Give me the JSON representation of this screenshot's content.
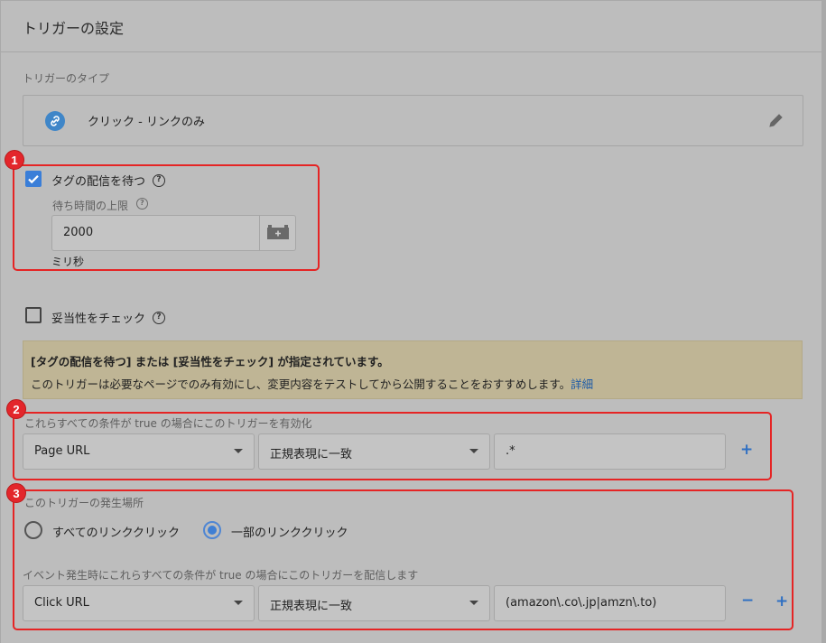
{
  "header": {
    "title": "トリガーの設定"
  },
  "trigger_type": {
    "label": "トリガーのタイプ",
    "value": "クリック - リンクのみ",
    "icon": "link-icon",
    "edit_icon": "pencil-icon",
    "accent_color": "#3f86c8"
  },
  "wait_for_tags": {
    "checked": true,
    "label": "タグの配信を待つ",
    "max_wait_label": "待ち時間の上限",
    "value": "2000",
    "unit": "ミリ秒"
  },
  "check_validation": {
    "checked": false,
    "label": "妥当性をチェック"
  },
  "notice": {
    "bold": "[タグの配信を待つ] または [妥当性をチェック] が指定されています。",
    "text": "このトリガーは必要なページでのみ有効にし、変更内容をテストしてから公開することをおすすめします。",
    "link": "詳細"
  },
  "enable_conditions": {
    "label": "これらすべての条件が true の場合にこのトリガーを有効化",
    "variable": "Page URL",
    "operator": "正規表現に一致",
    "value": ".*",
    "add": "+"
  },
  "fires_on": {
    "label": "このトリガーの発生場所",
    "options": [
      "すべてのリンククリック",
      "一部のリンククリック"
    ],
    "selected_index": 1,
    "condition_label": "イベント発生時にこれらすべての条件が true の場合にこのトリガーを配信します",
    "variable": "Click URL",
    "operator": "正規表現に一致",
    "value": "(amazon\\.co\\.jp|amzn\\.to)",
    "remove": "−",
    "add": "+"
  },
  "annotations": {
    "badges": [
      "1",
      "2",
      "3"
    ],
    "color": "#e52424"
  }
}
